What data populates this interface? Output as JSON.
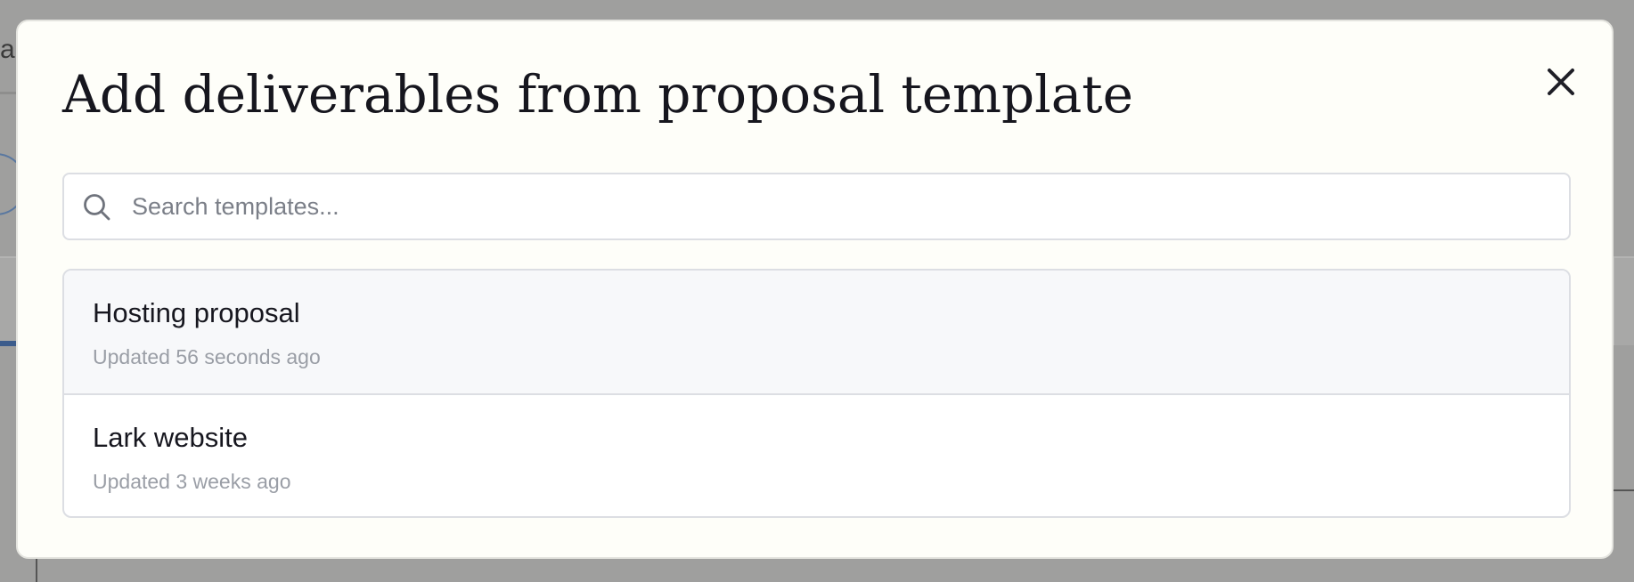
{
  "modal": {
    "title": "Add deliverables from proposal template",
    "close_icon": "close-icon"
  },
  "search": {
    "placeholder": "Search templates...",
    "value": "",
    "icon": "search-icon"
  },
  "templates": [
    {
      "name": "Hosting proposal",
      "updated": "Updated 56 seconds ago"
    },
    {
      "name": "Lark website",
      "updated": "Updated 3 weeks ago"
    }
  ],
  "colors": {
    "overlay": "#9f9f9e",
    "modal_bg": "#fefef9",
    "border": "#dcdee3",
    "hover_row": "#f7f8fa",
    "title_text": "#16161e",
    "muted_text": "#9a9ea6"
  }
}
